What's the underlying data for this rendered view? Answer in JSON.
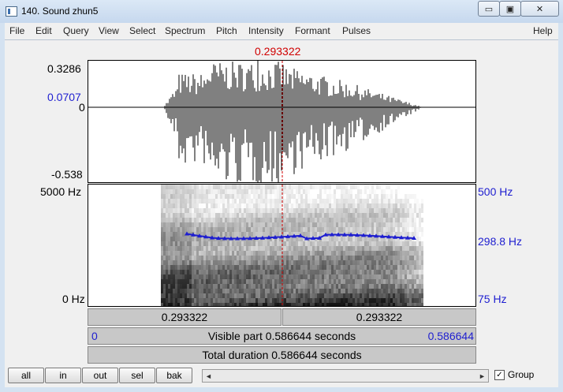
{
  "window": {
    "title": "140. Sound zhun5",
    "minimize": "▭",
    "maximize": "▣",
    "close": "✕"
  },
  "menu": [
    "File",
    "Edit",
    "Query",
    "View",
    "Select",
    "Spectrum",
    "Pitch",
    "Intensity",
    "Formant",
    "Pulses"
  ],
  "menu_help": "Help",
  "cursor_time": "0.293322",
  "waveform": {
    "max": "0.3286",
    "cursor_value": "0.0707",
    "zero": "0",
    "min": "-0.538"
  },
  "spectrogram": {
    "freq_top": "5000 Hz",
    "freq_bottom": "0 Hz"
  },
  "pitch": {
    "top": "500 Hz",
    "value": "298.8 Hz",
    "bottom": "75 Hz",
    "color": "#1e1ed0"
  },
  "bands": {
    "left_time": "0.293322",
    "right_time": "0.293322",
    "visible_start": "0",
    "visible_label": "Visible part 0.586644 seconds",
    "visible_end": "0.586644",
    "total_label": "Total duration 0.586644 seconds"
  },
  "buttons": {
    "all": "all",
    "in": "in",
    "out": "out",
    "sel": "sel",
    "bak": "bak"
  },
  "group": {
    "label": "Group",
    "checked": "✓"
  },
  "scroll": {
    "left": "◄",
    "right": "►"
  }
}
